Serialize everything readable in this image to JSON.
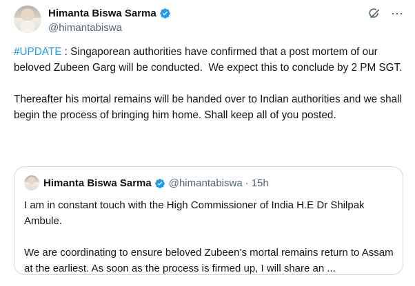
{
  "author": {
    "display_name": "Himanta Biswa Sarma",
    "handle": "@himantabiswa",
    "verified": true
  },
  "icons": {
    "verified": "verified-badge-icon",
    "grok": "grok-icon",
    "more": "more-icon"
  },
  "colors": {
    "accent": "#1d9bf0",
    "text": "#0f1419",
    "secondary": "#536471",
    "border": "#cfd9de"
  },
  "tweet": {
    "hashtag": "#UPDATE",
    "body": " : Singaporean authorities have confirmed that a post mortem of our beloved Zubeen Garg will be conducted.  We expect this to conclude by 2 PM SGT.\n\nThereafter his mortal remains will be handed over to Indian authorities and we shall begin the process of bringing him home. Shall keep all of you posted."
  },
  "quoted_tweet": {
    "display_name": "Himanta Biswa Sarma",
    "handle": "@himantabiswa",
    "separator": "·",
    "time": "15h",
    "text": "I am in constant touch with the High Commissioner of India H.E Dr Shilpak Ambule.\n\nWe are coordinating to ensure beloved Zubeen’s mortal remains return to Assam at the earliest. As soon as the process is firmed up, I will share an ..."
  }
}
